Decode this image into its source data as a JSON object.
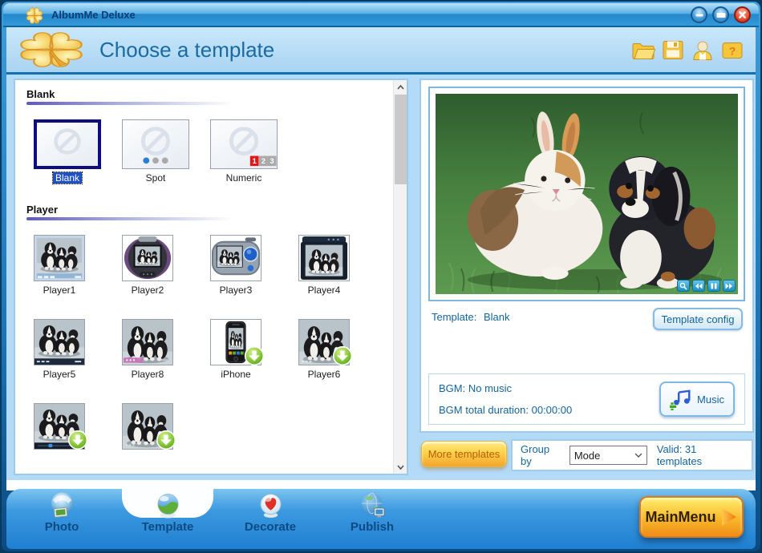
{
  "window": {
    "title": "AlbumMe Deluxe",
    "control_icons": [
      "minimize-icon",
      "maximize-icon",
      "close-icon"
    ]
  },
  "header": {
    "title": "Choose a template",
    "toolbar_icons": [
      "open-project-icon",
      "save-icon",
      "user-icon",
      "help-icon"
    ],
    "logo_icon": "clover-logo-icon"
  },
  "template_browser": {
    "sections": [
      {
        "name": "Blank",
        "thumb_size": "large",
        "rows": [
          [
            {
              "label": "Blank",
              "thumb": "blank",
              "selected": true,
              "download_badge": false
            },
            {
              "label": "Spot",
              "thumb": "spot",
              "selected": false,
              "download_badge": false
            },
            {
              "label": "Numeric",
              "thumb": "numeric",
              "selected": false,
              "download_badge": false
            }
          ]
        ]
      },
      {
        "name": "Player",
        "thumb_size": "small",
        "rows": [
          [
            {
              "label": "Player1",
              "thumb": "player1",
              "selected": false,
              "download_badge": false
            },
            {
              "label": "Player2",
              "thumb": "player2",
              "selected": false,
              "download_badge": false
            },
            {
              "label": "Player3",
              "thumb": "player3",
              "selected": false,
              "download_badge": false
            },
            {
              "label": "Player4",
              "thumb": "player4",
              "selected": false,
              "download_badge": false
            }
          ],
          [
            {
              "label": "Player5",
              "thumb": "player5",
              "selected": false,
              "download_badge": false
            },
            {
              "label": "Player8",
              "thumb": "player8",
              "selected": false,
              "download_badge": false
            },
            {
              "label": "iPhone",
              "thumb": "iphone",
              "selected": false,
              "download_badge": true
            },
            {
              "label": "Player6",
              "thumb": "player6",
              "selected": false,
              "download_badge": true
            }
          ],
          [
            {
              "label": "",
              "thumb": "player9",
              "selected": false,
              "download_badge": true
            },
            {
              "label": "",
              "thumb": "player10",
              "selected": false,
              "download_badge": true
            }
          ]
        ]
      }
    ]
  },
  "preview": {
    "template_label": "Template:",
    "template_value": "Blank",
    "config_button": "Template config",
    "control_icons": [
      "zoom-icon",
      "rewind-icon",
      "pause-icon",
      "fast-forward-icon"
    ]
  },
  "bgm": {
    "line1": "BGM: No music",
    "line2": "BGM total duration: 00:00:00",
    "music_button": "Music"
  },
  "footer_controls": {
    "more_templates_button": "More templates",
    "group_by_label": "Group by",
    "group_by_value": "Mode",
    "valid_text": "Valid: 31 templates"
  },
  "tabs": [
    {
      "label": "Photo",
      "icon": "photo-icon",
      "active": false
    },
    {
      "label": "Template",
      "icon": "template-icon",
      "active": true
    },
    {
      "label": "Decorate",
      "icon": "decorate-icon",
      "active": false
    },
    {
      "label": "Publish",
      "icon": "publish-icon",
      "active": false
    }
  ],
  "main_menu_button": "MainMenu",
  "colors": {
    "accent_blue": "#1372ae",
    "text_blue": "#14649e",
    "selection_blue": "#1e50c8",
    "button_orange": "#f2a52c",
    "badge_green": "#5aa81e",
    "close_red": "#e84a30",
    "toolbar_blue": "#1f7fd0"
  }
}
